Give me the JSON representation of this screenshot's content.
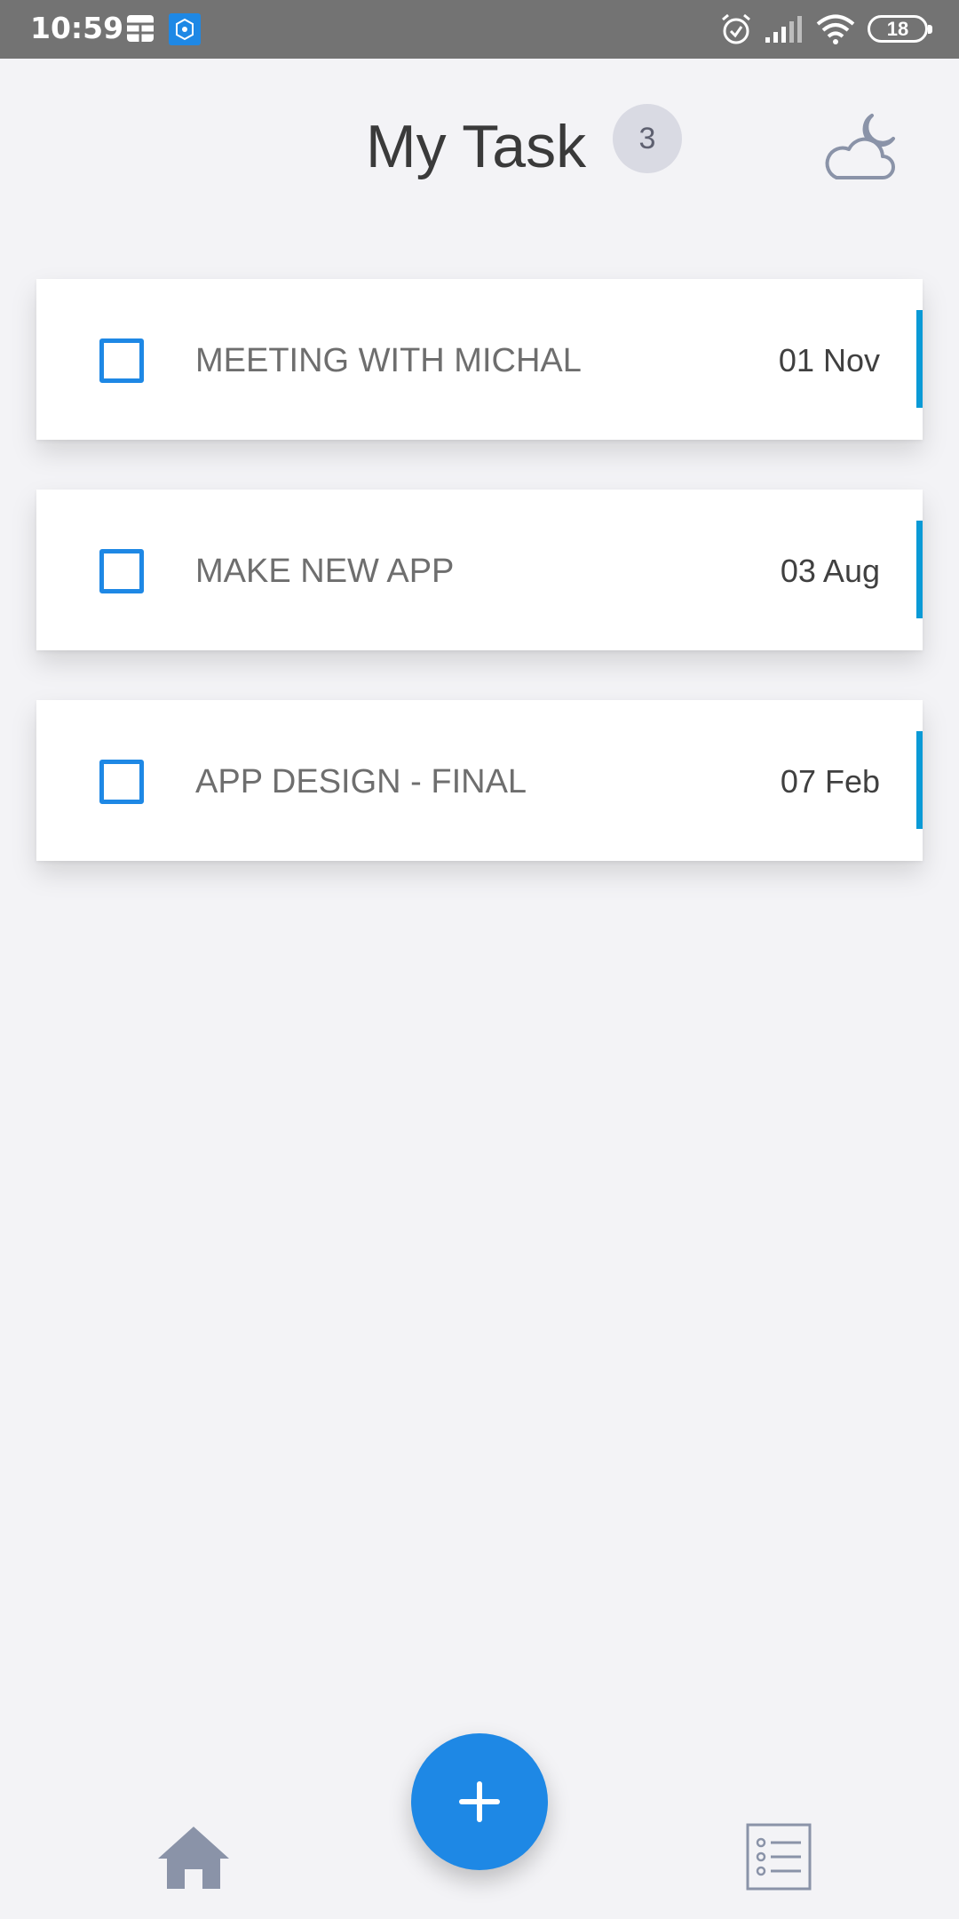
{
  "status_bar": {
    "time": "10:59",
    "battery": "18",
    "icons": [
      "grid-app-icon",
      "notification-app-icon",
      "alarm-icon",
      "signal-icon",
      "wifi-icon",
      "battery-icon"
    ]
  },
  "header": {
    "title": "My Task",
    "count": "3",
    "weather_icon": "cloud-moon-icon"
  },
  "tasks": [
    {
      "title": "MEETING WITH MICHAL",
      "date": "01 Nov",
      "checked": false
    },
    {
      "title": "MAKE NEW APP",
      "date": "03 Aug",
      "checked": false
    },
    {
      "title": "APP DESIGN - FINAL",
      "date": "07 Feb",
      "checked": false
    }
  ],
  "bottom_nav": {
    "left_icon": "home-icon",
    "fab_icon": "plus-icon",
    "right_icon": "task-list-icon"
  },
  "colors": {
    "accent": "#1e88e5",
    "task_marker": "#0a9ad6",
    "background": "#f3f3f6",
    "status_bar": "#737373",
    "nav_icon": "#8a93a8"
  }
}
